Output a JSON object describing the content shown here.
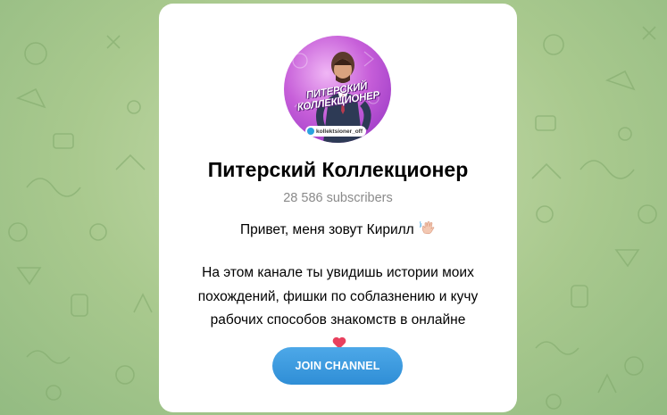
{
  "channel": {
    "avatar_text_line1": "ПИТЕРСКИЙ",
    "avatar_text_line2": "КОЛЛЕКЦИОНЕР",
    "avatar_handle": "kollektsioner_off",
    "title": "Питерский Коллекционер",
    "subscribers": "28 586 subscribers",
    "greeting": "Привет, меня зовут Кирилл",
    "description_lines": [
      "На этом канале ты увидишь истории моих",
      "похождений, фишки по соблазнению и кучу",
      "рабочих способов знакомств в онлайне",
      "…"
    ]
  },
  "actions": {
    "join_label": "JOIN CHANNEL"
  },
  "icons": {
    "greeting_emoji": "waving-hand-icon",
    "description_emoji": "heart-icon"
  },
  "colors": {
    "background": "#a9c98e",
    "join_button": "#3a9ade",
    "subscribers_text": "#8a8a8a"
  }
}
